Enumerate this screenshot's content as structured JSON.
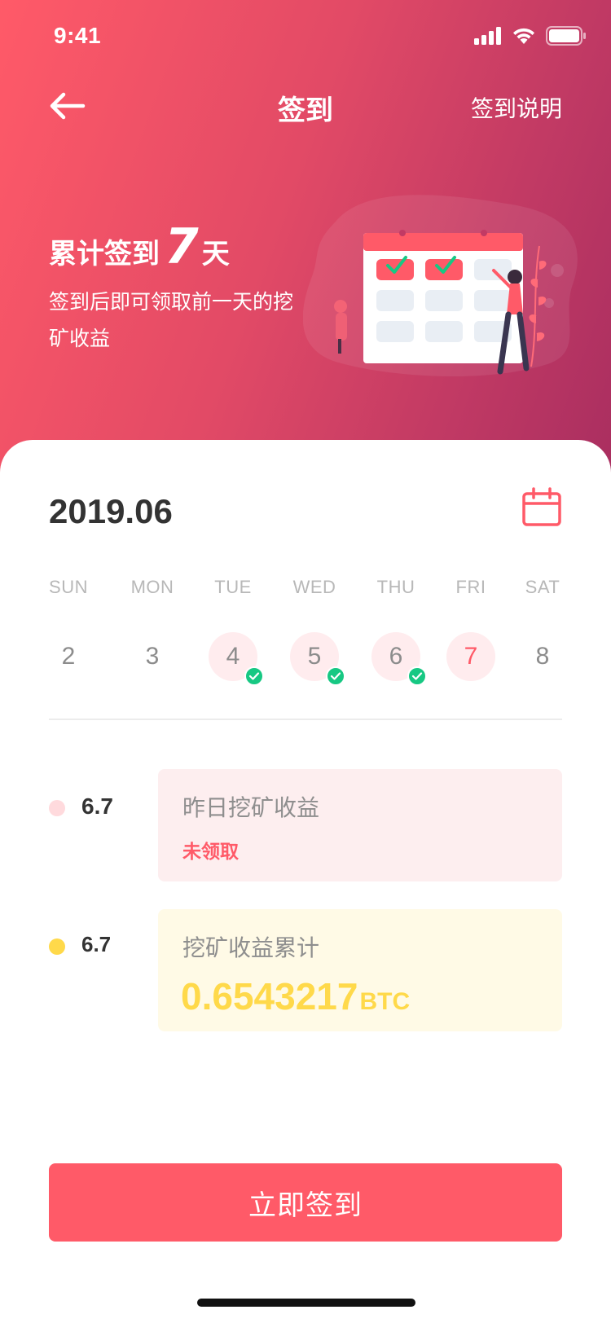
{
  "status_bar": {
    "time": "9:41"
  },
  "nav": {
    "title": "签到",
    "help_label": "签到说明"
  },
  "streak": {
    "prefix": "累计签到",
    "days": "7",
    "unit": "天",
    "description": "签到后即可领取前一天的挖矿收益"
  },
  "calendar": {
    "month": "2019.06",
    "weekdays": [
      "SUN",
      "MON",
      "TUE",
      "WED",
      "THU",
      "FRI",
      "SAT"
    ],
    "days": [
      {
        "label": "2",
        "state": "normal"
      },
      {
        "label": "3",
        "state": "normal"
      },
      {
        "label": "4",
        "state": "signed"
      },
      {
        "label": "5",
        "state": "signed"
      },
      {
        "label": "6",
        "state": "signed"
      },
      {
        "label": "7",
        "state": "today"
      },
      {
        "label": "8",
        "state": "normal"
      }
    ]
  },
  "rewards": {
    "yesterday": {
      "value": "6.7",
      "label": "昨日挖矿收益",
      "status": "未领取"
    },
    "total": {
      "value": "6.7",
      "label": "挖矿收益累计",
      "amount": "0.6543217",
      "unit": "BTC"
    }
  },
  "cta": {
    "label": "立即签到"
  },
  "colors": {
    "primary": "#ff5a68",
    "success": "#17c883",
    "gold": "#ffd94a",
    "hero_end": "#a92e60"
  },
  "icons": {
    "back": "arrow-left-icon",
    "calendar": "calendar-icon",
    "check": "check-icon"
  }
}
